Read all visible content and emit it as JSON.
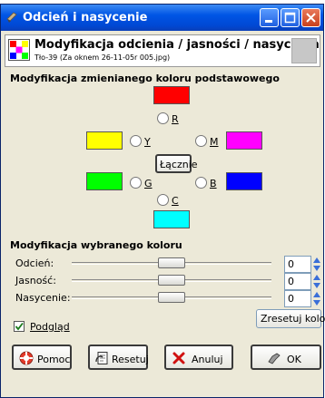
{
  "window": {
    "title": "Odcień i nasycenie"
  },
  "header": {
    "title": "Modyfikacja odcienia / jasności / nasycenia",
    "subtitle": "Tło-39 (Za oknem 26-11-05r 005.jpg)"
  },
  "primary_section": {
    "heading": "Modyfikacja zmienianego koloru podstawowego",
    "colors": [
      {
        "key": "R",
        "label": "R",
        "color": "#ff0000"
      },
      {
        "key": "Y",
        "label": "Y",
        "color": "#ffff00"
      },
      {
        "key": "M",
        "label": "M",
        "color": "#ff00ff"
      },
      {
        "key": "G",
        "label": "G",
        "color": "#00ff00"
      },
      {
        "key": "B",
        "label": "B",
        "color": "#0000ff"
      },
      {
        "key": "C",
        "label": "C",
        "color": "#00ffff"
      }
    ],
    "master_button": "Łącznie"
  },
  "adjust_section": {
    "heading": "Modyfikacja wybranego koloru",
    "sliders": [
      {
        "label": "Odcień:",
        "value": "0",
        "level": 0.5
      },
      {
        "label": "Jasność:",
        "value": "0",
        "level": 0.5
      },
      {
        "label": "Nasycenie:",
        "value": "0",
        "level": 0.5
      }
    ],
    "reset_color": "Zresetuj kolor"
  },
  "preview": {
    "label": "Podgląd",
    "checked": true
  },
  "buttons": {
    "help": "Pomoc",
    "reset": "Resetuj",
    "cancel": "Anuluj",
    "ok": "OK"
  },
  "colors": {
    "title_bar": "#0055e5",
    "dialog_bg": "#ece9d8"
  }
}
